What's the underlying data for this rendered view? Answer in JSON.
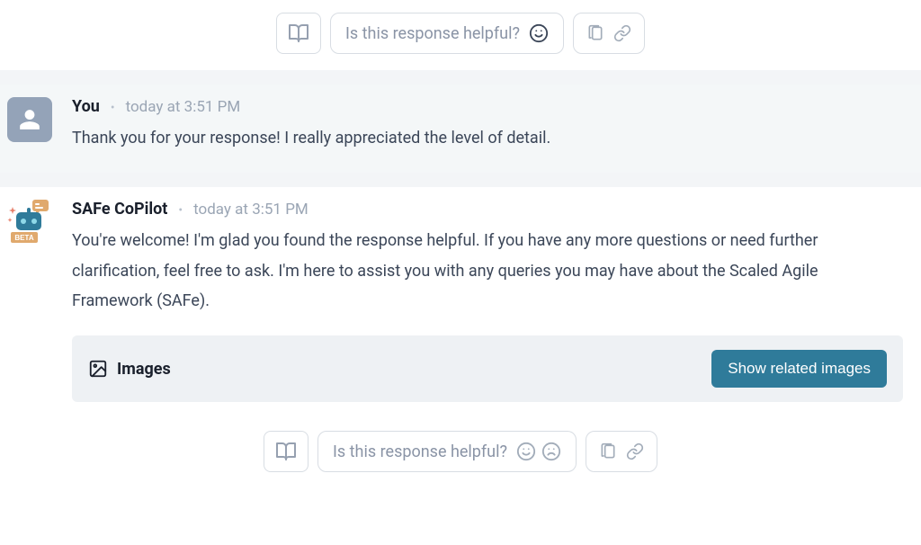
{
  "feedback": {
    "prompt": "Is this response helpful?"
  },
  "messages": {
    "user": {
      "name": "You",
      "time": "today at 3:51 PM",
      "text": "Thank you for your response! I really appreciated the level of detail."
    },
    "bot": {
      "name": "SAFe CoPilot",
      "time": "today at 3:51 PM",
      "text": "You're welcome! I'm glad you found the response helpful. If you have any more questions or need further clarification, feel free to ask. I'm here to assist you with any queries you may have about the Scaled Agile Framework (SAFe).",
      "badge": "BETA"
    }
  },
  "images_panel": {
    "label": "Images",
    "button": "Show related images"
  }
}
